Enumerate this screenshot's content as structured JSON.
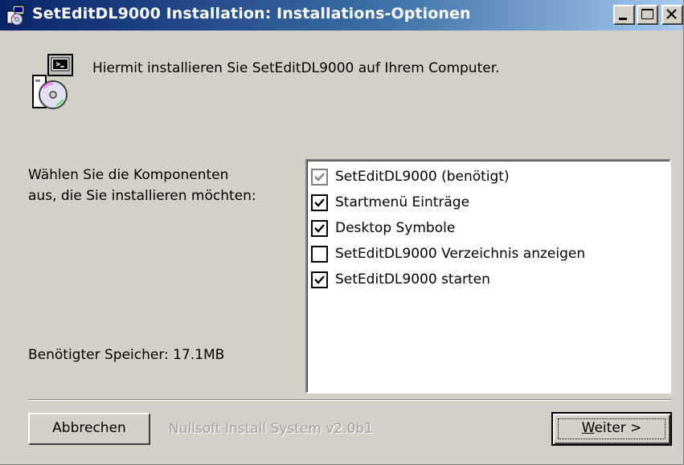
{
  "window": {
    "title": "SetEditDL9000 Installation: Installations-Optionen",
    "title_icon": "installer-icon",
    "controls": {
      "minimize": "minimize-icon",
      "maximize": "maximize-icon",
      "close": "close-icon"
    }
  },
  "header": {
    "icon": "installer-cd-icon",
    "text": "Hiermit installieren Sie SetEditDL9000 auf Ihrem Computer."
  },
  "components": {
    "label": "Wählen Sie die Komponenten\naus, die Sie installieren möchten:",
    "items": [
      {
        "label": "SetEditDL9000 (benötigt)",
        "checked": true,
        "disabled": true
      },
      {
        "label": "Startmenü Einträge",
        "checked": true,
        "disabled": false
      },
      {
        "label": "Desktop Symbole",
        "checked": true,
        "disabled": false
      },
      {
        "label": "SetEditDL9000 Verzeichnis anzeigen",
        "checked": false,
        "disabled": false
      },
      {
        "label": "SetEditDL9000 starten",
        "checked": true,
        "disabled": false
      }
    ]
  },
  "space_required": "Benötigter Speicher: 17.1MB",
  "footer": {
    "cancel_label": "Abbrechen",
    "branding": "Nullsoft Install System v2.0b1",
    "next_label_accel": "W",
    "next_label_rest": "eiter >"
  },
  "colors": {
    "title_start": "#0a246a",
    "title_end": "#a6caf0",
    "face": "#d4d0c8",
    "checkmark": "#000000",
    "checkmark_disabled": "#808080"
  }
}
